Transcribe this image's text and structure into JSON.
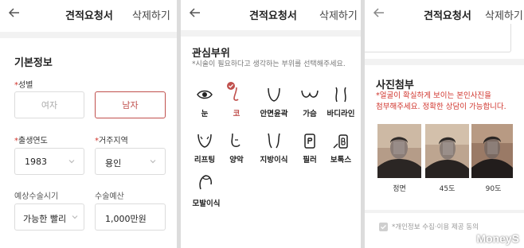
{
  "header": {
    "title": "견적요청서",
    "delete_label": "삭제하기"
  },
  "panel1": {
    "section_title": "기본정보",
    "gender": {
      "label": "성별",
      "options": [
        "여자",
        "남자"
      ],
      "selected": "남자"
    },
    "birth_year": {
      "label": "출생연도",
      "value": "1983"
    },
    "residence": {
      "label": "거주지역",
      "value": "용인"
    },
    "surgery_time": {
      "label": "예상수술시기",
      "value": "가능한 빨리"
    },
    "budget": {
      "label": "수술예산",
      "value": "1,000만원"
    }
  },
  "panel2": {
    "section_title": "관심부위",
    "hint": "*시술이 필요하다고 생각하는 부위를 선택해주세요.",
    "parts": [
      {
        "label": "눈",
        "icon": "eye-icon",
        "selected": false
      },
      {
        "label": "코",
        "icon": "nose-icon",
        "selected": true
      },
      {
        "label": "안면윤곽",
        "icon": "face-contour-icon",
        "selected": false
      },
      {
        "label": "가슴",
        "icon": "chest-icon",
        "selected": false
      },
      {
        "label": "바디라인",
        "icon": "body-line-icon",
        "selected": false
      },
      {
        "label": "리프팅",
        "icon": "lifting-icon",
        "selected": false
      },
      {
        "label": "양악",
        "icon": "jaw-icon",
        "selected": false
      },
      {
        "label": "지방이식",
        "icon": "fat-graft-icon",
        "selected": false
      },
      {
        "label": "필러",
        "icon": "filler-icon",
        "selected": false
      },
      {
        "label": "보톡스",
        "icon": "botox-icon",
        "selected": false
      },
      {
        "label": "모발이식",
        "icon": "hair-transplant-icon",
        "selected": false
      }
    ]
  },
  "panel3": {
    "section_title": "사진첨부",
    "note_line1": "*얼굴이 확실하게 보이는 본인사진을",
    "note_line2": "첨부해주세요. 정확한 상담이 가능합니다.",
    "photos": [
      {
        "caption": "정면"
      },
      {
        "caption": "45도"
      },
      {
        "caption": "90도"
      }
    ],
    "agree_text": "*개인정보 수집·이용 제공 동의"
  },
  "watermark": "MoneyS",
  "colors": {
    "accent": "#c0504d",
    "required_star": "#d0342c"
  }
}
